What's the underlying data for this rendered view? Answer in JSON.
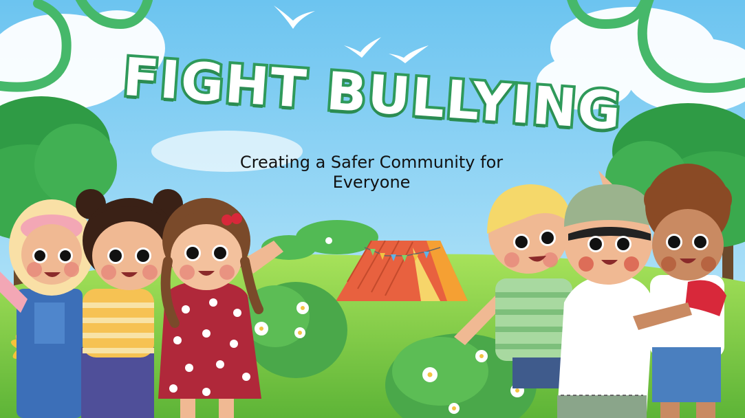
{
  "poster": {
    "title": "FIGHT BULLYING",
    "subtitle": "Creating a Safer Community for Everyone"
  },
  "colors": {
    "sky": "#8fd3f4",
    "grass": "#7cc93f",
    "title_outline": "#2f9a5a",
    "tent": "#e8613f"
  },
  "scene_elements": [
    "sky",
    "clouds",
    "birds",
    "green-ribbons",
    "trees",
    "grass",
    "tent",
    "flower-bushes",
    "child-hijab",
    "child-striped-shirt",
    "child-polka-dot-dress",
    "child-blond-striped-shirt",
    "child-cap-white-shirt",
    "child-curly-hair-red-sleeve"
  ]
}
